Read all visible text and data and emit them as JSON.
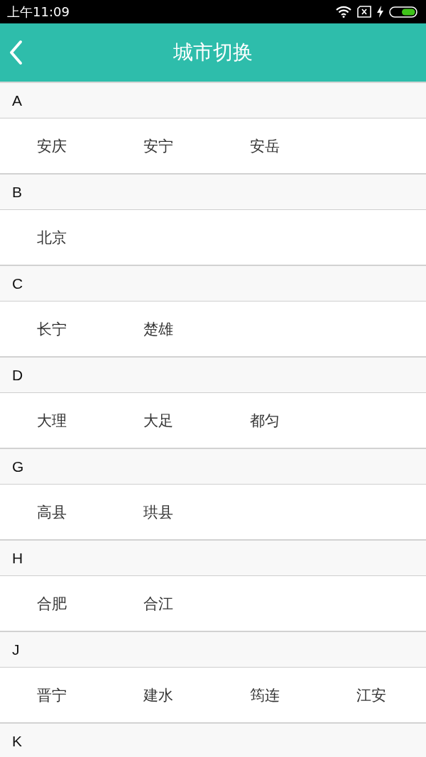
{
  "status_bar": {
    "time": "上午11:09"
  },
  "header": {
    "title": "城市切换"
  },
  "sections": [
    {
      "letter": "A",
      "cities": [
        "安庆",
        "安宁",
        "安岳"
      ]
    },
    {
      "letter": "B",
      "cities": [
        "北京"
      ]
    },
    {
      "letter": "C",
      "cities": [
        "长宁",
        "楚雄"
      ]
    },
    {
      "letter": "D",
      "cities": [
        "大理",
        "大足",
        "都匀"
      ]
    },
    {
      "letter": "G",
      "cities": [
        "高县",
        "珙县"
      ]
    },
    {
      "letter": "H",
      "cities": [
        "合肥",
        "合江"
      ]
    },
    {
      "letter": "J",
      "cities": [
        "晋宁",
        "建水",
        "筠连",
        "江安"
      ]
    },
    {
      "letter": "K"
    }
  ]
}
